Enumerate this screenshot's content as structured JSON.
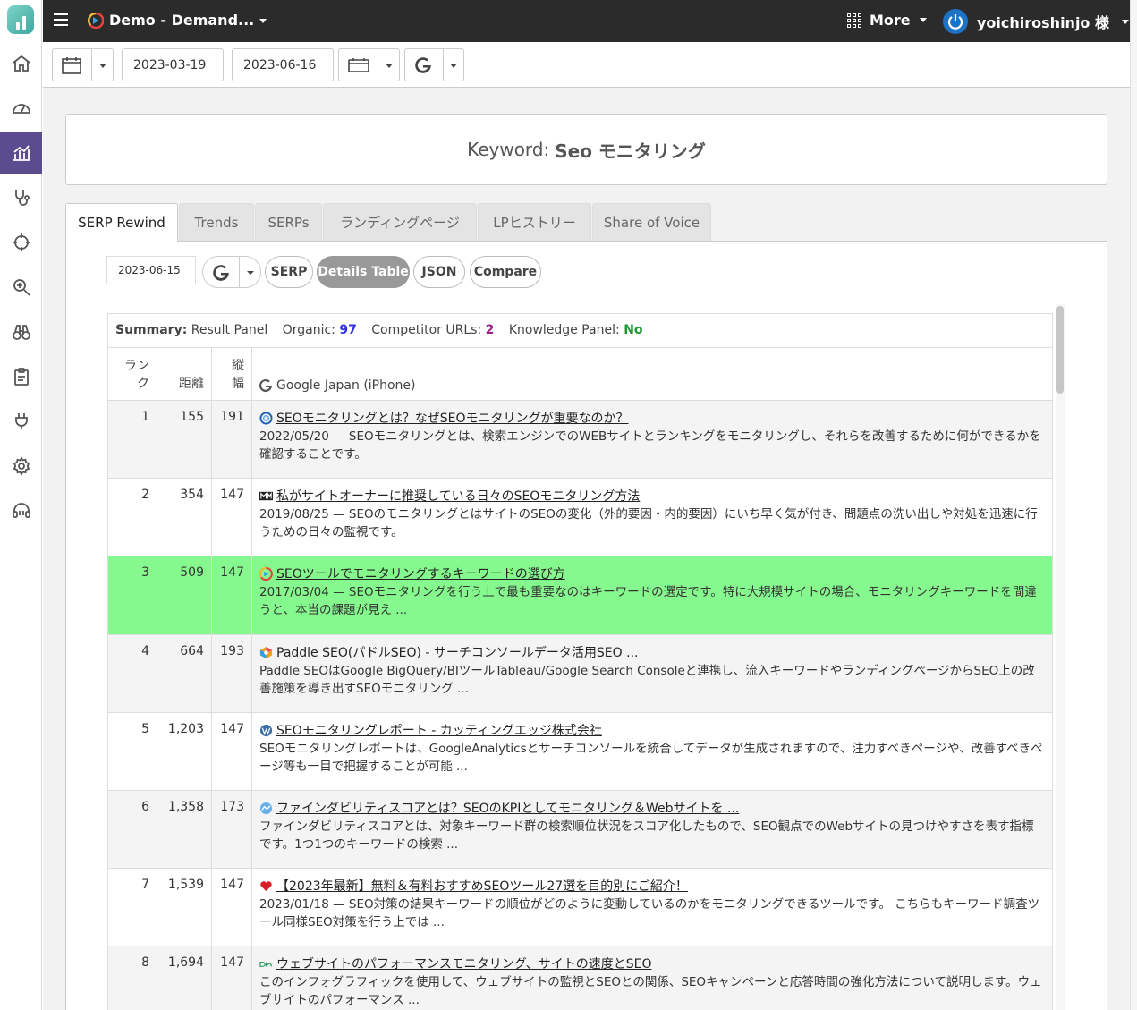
{
  "topbar": {
    "project_title": "Demo - Demand...",
    "more_label": "More",
    "user_name": "yoichiroshinjo 様"
  },
  "toolbar": {
    "start_date": "2023-03-19",
    "end_date": "2023-06-16"
  },
  "keyword": {
    "prefix": "Keyword:",
    "value": "Seo モニタリング"
  },
  "tabs": [
    {
      "label": "SERP Rewind",
      "active": true
    },
    {
      "label": "Trends"
    },
    {
      "label": "SERPs"
    },
    {
      "label": "ランディングページ"
    },
    {
      "label": "LPヒストリー"
    },
    {
      "label": "Share of Voice"
    }
  ],
  "controls": {
    "serp_date": "2023-06-15",
    "buttons": [
      "SERP",
      "Details Table",
      "JSON",
      "Compare"
    ],
    "active_button": "Details Table"
  },
  "summary": {
    "label": "Summary:",
    "result_panel": "Result Panel",
    "organic_label": "Organic:",
    "organic_value": "97",
    "competitor_label": "Competitor URLs:",
    "competitor_value": "2",
    "kp_label": "Knowledge Panel:",
    "kp_value": "No"
  },
  "table": {
    "headers": {
      "rank_1": "ラン",
      "rank_2": "ク",
      "distance": "距離",
      "height_1": "縦",
      "height_2": "幅",
      "engine": "Google Japan (iPhone)"
    },
    "rows": [
      {
        "rank": "1",
        "distance": "155",
        "height": "191",
        "title": "SEOモニタリングとは？なぜSEOモニタリングが重要なのか？",
        "snippet": "2022/05/20 — SEOモニタリングとは、検索エンジンでのWEBサイトとランキングをモニタリングし、それらを改善するために何ができるかを確認することです。"
      },
      {
        "rank": "2",
        "distance": "354",
        "height": "147",
        "title": "私がサイトオーナーに推奨している日々のSEOモニタリング方法",
        "snippet": "2019/08/25 — SEOのモニタリングとはサイトのSEOの変化（外的要因・内的要因）にいち早く気が付き、問題点の洗い出しや対処を迅速に行うための日々の監視です。"
      },
      {
        "rank": "3",
        "distance": "509",
        "height": "147",
        "title": "SEOツールでモニタリングするキーワードの選び方",
        "snippet": "2017/03/04 — SEOモニタリングを行う上で最も重要なのはキーワードの選定です。特に大規模サイトの場合、モニタリングキーワードを間違うと、本当の課題が見え ..."
      },
      {
        "rank": "4",
        "distance": "664",
        "height": "193",
        "title": "Paddle SEO(パドルSEO) - サーチコンソールデータ活用SEO ...",
        "snippet": "Paddle SEOはGoogle BigQuery/BIツールTableau/Google Search Consoleと連携し、流入キーワードやランディングページからSEO上の改善施策を導き出すSEOモニタリング ..."
      },
      {
        "rank": "5",
        "distance": "1,203",
        "height": "147",
        "title": "SEOモニタリングレポート - カッティングエッジ株式会社",
        "snippet": "SEOモニタリングレポートは、GoogleAnalyticsとサーチコンソールを統合してデータが生成されますので、注力すべきページや、改善すべきページ等も一目で把握することが可能 ..."
      },
      {
        "rank": "6",
        "distance": "1,358",
        "height": "173",
        "title": "ファインダビリティスコアとは？SEOのKPIとしてモニタリング＆Webサイトを ...",
        "snippet": "ファインダビリティスコアとは、対象キーワード群の検索順位状況をスコア化したもので、SEO観点でのWebサイトの見つけやすさを表す指標です。1つ1つのキーワードの検索 ..."
      },
      {
        "rank": "7",
        "distance": "1,539",
        "height": "147",
        "title": "【2023年最新】無料＆有料おすすめSEOツール27選を目的別にご紹介！",
        "snippet": "2023/01/18 — SEO対策の結果キーワードの順位がどのように変動しているのかをモニタリングできるツールです。 こちらもキーワード調査ツール同様SEO対策を行う上では ..."
      },
      {
        "rank": "8",
        "distance": "1,694",
        "height": "147",
        "title": "ウェブサイトのパフォーマンスモニタリング、サイトの速度とSEO",
        "snippet": "このインフォグラフィックを使用して、ウェブサイトの監視とSEOとの関係、SEOキャンペーンと応答時間の強化方法について説明します。ウェブサイトのパフォーマンス ..."
      }
    ]
  },
  "colors": {
    "sidebar_active": "#5b4c8f",
    "topbar_bg": "#2b2b2b",
    "highlight_row": "#86f98e",
    "organic": "#3030e0",
    "competitor": "#a0208a",
    "knowledge_panel": "#1a9a30"
  }
}
